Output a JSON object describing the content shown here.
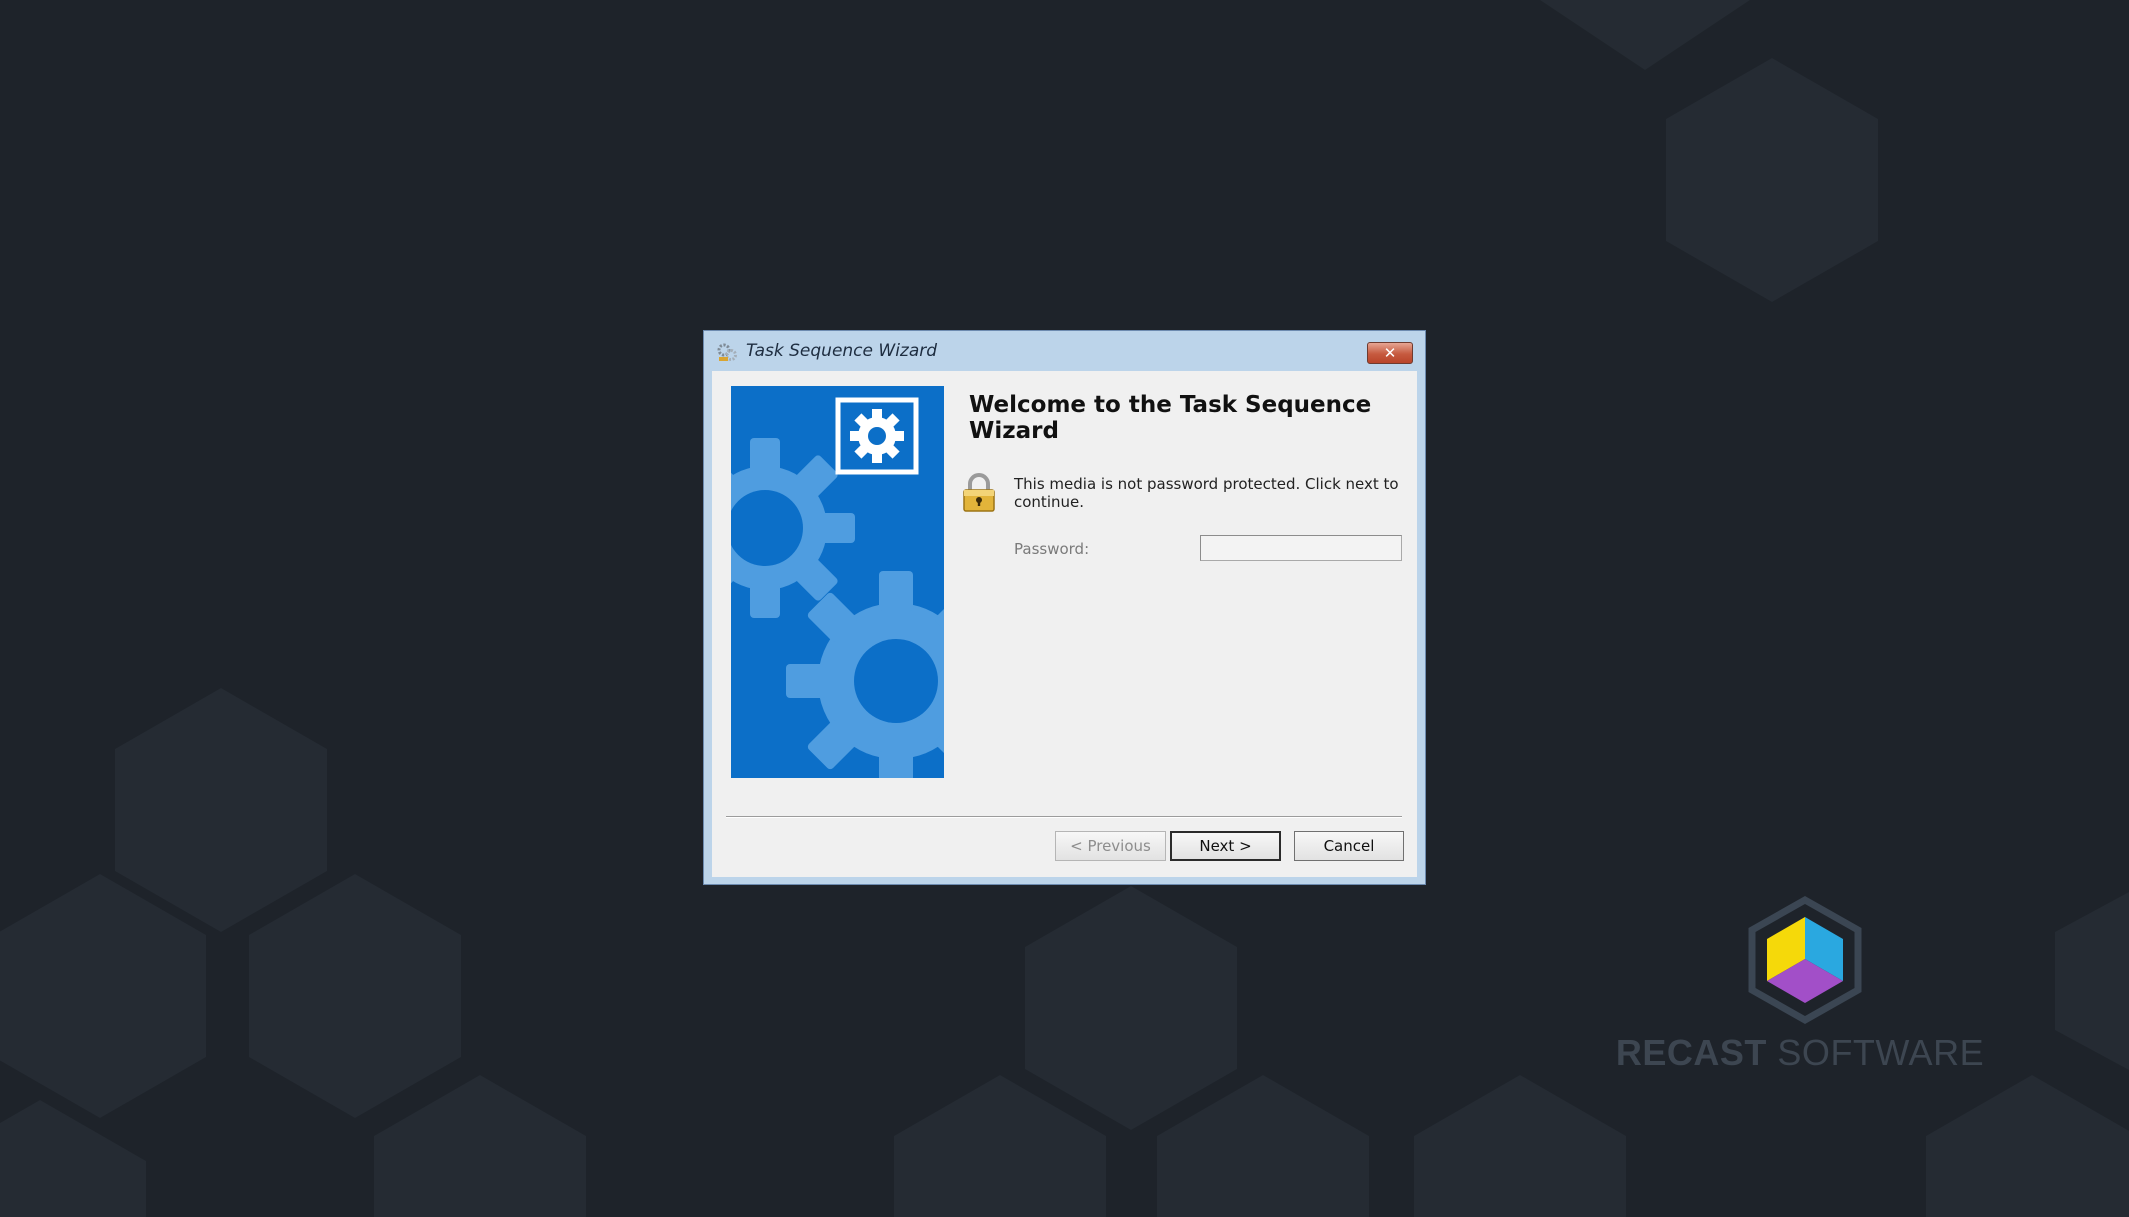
{
  "dialog": {
    "title": "Task Sequence Wizard",
    "close_label": "✕",
    "heading": "Welcome to the Task Sequence Wizard",
    "message": "This media is not password protected.  Click next to continue.",
    "password_label": "Password:",
    "password_value": "",
    "buttons": {
      "previous": "< Previous",
      "next": "Next >",
      "cancel": "Cancel"
    },
    "icons": {
      "title": "task-sequence-icon",
      "banner": "gear-icon",
      "status": "lock-icon"
    }
  },
  "branding": {
    "name_bold": "RECAST",
    "name_regular": " SOFTWARE",
    "logo": "recast-cube-logo"
  },
  "colors": {
    "background": "#1e232a",
    "banner_blue": "#0c6fc8",
    "logo_yellow": "#f5d90a",
    "logo_cyan": "#2aa8e0",
    "logo_purple": "#a24fc8"
  }
}
